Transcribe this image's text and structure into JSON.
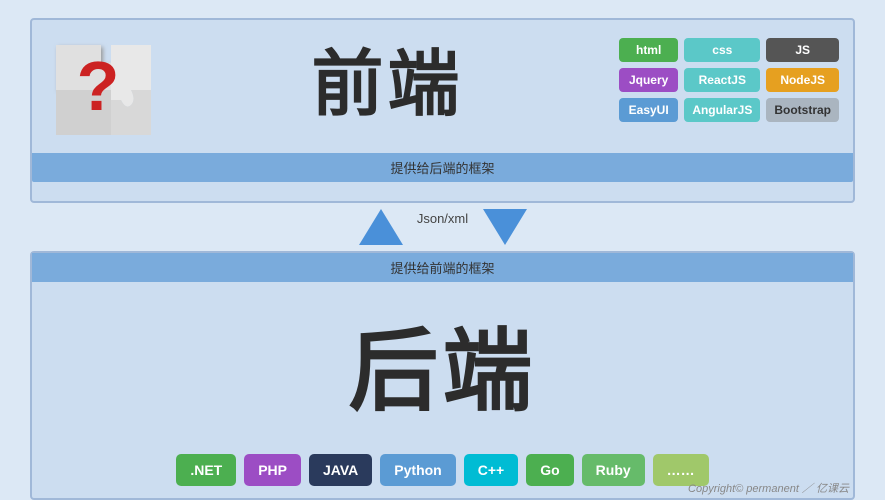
{
  "frontend": {
    "title": "前端",
    "provide_bar": "提供给后端的框架",
    "tags": [
      {
        "label": "html",
        "class": "tag-html"
      },
      {
        "label": "css",
        "class": "tag-css"
      },
      {
        "label": "JS",
        "class": "tag-js"
      },
      {
        "label": "Jquery",
        "class": "tag-jquery"
      },
      {
        "label": "ReactJS",
        "class": "tag-reactjs"
      },
      {
        "label": "NodeJS",
        "class": "tag-nodejs"
      },
      {
        "label": "EasyUI",
        "class": "tag-easyui"
      },
      {
        "label": "AngularJS",
        "class": "tag-angularjs"
      },
      {
        "label": "Bootstrap",
        "class": "tag-bootstrap"
      }
    ]
  },
  "arrows": {
    "label": "Json/xml"
  },
  "backend": {
    "title": "后端",
    "provide_bar": "提供给前端的框架",
    "tags": [
      {
        "label": ".NET",
        "class": "btag-net"
      },
      {
        "label": "PHP",
        "class": "btag-php"
      },
      {
        "label": "JAVA",
        "class": "btag-java"
      },
      {
        "label": "Python",
        "class": "btag-python"
      },
      {
        "label": "C++",
        "class": "btag-cpp"
      },
      {
        "label": "Go",
        "class": "btag-go"
      },
      {
        "label": "Ruby",
        "class": "btag-ruby"
      },
      {
        "label": "……",
        "class": "btag-more"
      }
    ]
  },
  "copyright": {
    "text": "Copyright© permanent ／ 亿课云"
  }
}
